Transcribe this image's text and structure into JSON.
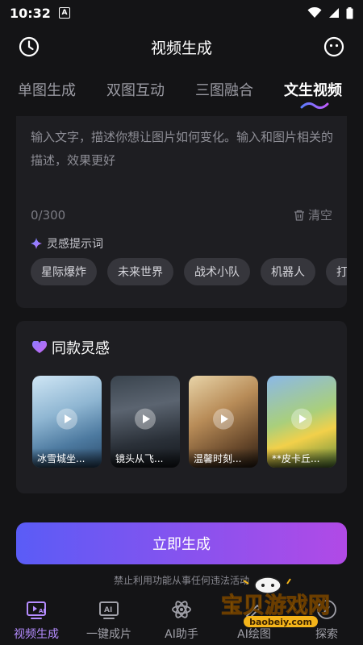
{
  "status": {
    "time": "10:32",
    "a_glyph": "A"
  },
  "header": {
    "title": "视频生成",
    "left_icon": "clock-icon",
    "right_icon": "smiley-icon"
  },
  "tabs": [
    {
      "label": "单图生成"
    },
    {
      "label": "双图互动"
    },
    {
      "label": "三图融合"
    },
    {
      "label": "文生视频"
    }
  ],
  "active_tab": "文生视频",
  "prompt": {
    "placeholder": "输入文字，描述你想让图片如何变化。输入和图片相关的描述，效果更好",
    "counter": "0/300",
    "clear_label": "清空"
  },
  "inspiration": {
    "title": "灵感提示词",
    "chips": [
      "星际爆炸",
      "未来世界",
      "战术小队",
      "机器人",
      "打"
    ]
  },
  "same_inspiration": {
    "title": "同款灵感",
    "items": [
      {
        "caption": "冰雪城坐..."
      },
      {
        "caption": "镜头从飞..."
      },
      {
        "caption": "温馨时刻..."
      },
      {
        "caption": "**皮卡丘..."
      }
    ]
  },
  "generate_button": "立即生成",
  "disclaimer": "禁止利用功能从事任何违法活动",
  "bottom_nav": [
    {
      "label": "视频生成",
      "icon": "video-ai-icon"
    },
    {
      "label": "一键成片",
      "icon": "ai-film-icon"
    },
    {
      "label": "AI助手",
      "icon": "atom-icon"
    },
    {
      "label": "AI绘图",
      "icon": "paint-icon"
    },
    {
      "label": "探索",
      "icon": "compass-icon"
    }
  ],
  "watermark": {
    "text": "宝贝游戏网",
    "url": "baobeiy.com"
  },
  "colors": {
    "accent": "#b58cff",
    "button_start": "#5a5cf6",
    "button_end": "#b14ae6",
    "background": "#141416"
  }
}
